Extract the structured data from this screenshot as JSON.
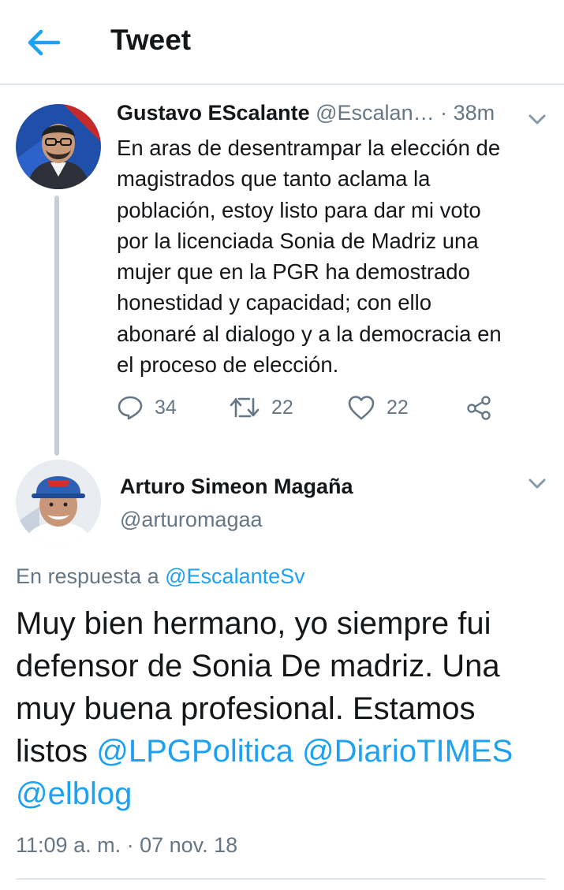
{
  "header": {
    "title": "Tweet",
    "back_icon": "arrow-left-icon"
  },
  "colors": {
    "accent": "#1da1f2",
    "secondary_text": "#657786",
    "primary_text": "#14171a",
    "divider": "#e1e8ed"
  },
  "tweet1": {
    "name": "Gustavo EScalante",
    "handle": "@Escalan…",
    "dot": "·",
    "time": "38m",
    "text": "En aras de desentrampar la elección de\nmagistrados que tanto aclama la\npoblación, estoy listo para dar mi voto\npor la licenciada Sonia de Madriz una\nmujer que en la PGR ha demostrado\nhonestidad y capacidad; con ello\nabonaré al dialogo y a la democracia en\nel proceso de elección.",
    "replies": "34",
    "retweets": "22",
    "likes": "22"
  },
  "tweet2": {
    "name": "Arturo Simeon Magaña",
    "handle": "@arturomagaa",
    "reply_prefix": "En respuesta a",
    "reply_mention": "@EscalanteSv",
    "text_plain": "Muy bien hermano, yo siempre fui defensor de Sonia De madriz. Una muy buena profesional. Estamos listos",
    "mentions": [
      "@LPGPolitica",
      "@DiarioTIMES",
      "@elblog"
    ],
    "timestamp": "11:09 a. m. · 07 nov. 18"
  }
}
